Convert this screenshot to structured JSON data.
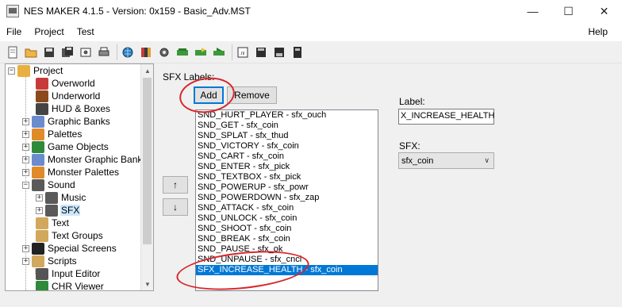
{
  "window": {
    "title": "NES MAKER 4.1.5 - Version: 0x159 - Basic_Adv.MST",
    "min": "—",
    "max": "☐",
    "close": "✕"
  },
  "menu": {
    "file": "File",
    "project": "Project",
    "test": "Test",
    "help": "Help"
  },
  "toolbar": {
    "icons": [
      "new-file-icon",
      "open-folder-icon",
      "save-icon",
      "save-all-icon",
      "export-icon",
      "print-icon",
      "globe-icon",
      "palette-icon",
      "settings-gear-icon",
      "build-icon",
      "build-run-icon",
      "run-icon",
      "asm-icon",
      "disk-icon",
      "disk2-icon",
      "disk3-icon"
    ]
  },
  "tree": {
    "root": "Project",
    "items": [
      {
        "label": "Overworld",
        "icon_color": "#c83a3a"
      },
      {
        "label": "Underworld",
        "icon_color": "#8c4a1c"
      },
      {
        "label": "HUD & Boxes",
        "icon_color": "#444444"
      },
      {
        "label": "Graphic Banks",
        "icon_color": "#6a8ccf"
      },
      {
        "label": "Palettes",
        "icon_color": "#e08a2a"
      },
      {
        "label": "Game Objects",
        "icon_color": "#2f8a3c"
      },
      {
        "label": "Monster Graphic Banks",
        "icon_color": "#6a8ccf"
      },
      {
        "label": "Monster Palettes",
        "icon_color": "#e08a2a"
      },
      {
        "label": "Sound",
        "icon_color": "#5a5a5a"
      },
      {
        "label": "Music",
        "icon_color": "#5a5a5a"
      },
      {
        "label": "SFX",
        "icon_color": "#5a5a5a"
      },
      {
        "label": "Text",
        "icon_color": "#d2a85c"
      },
      {
        "label": "Text Groups",
        "icon_color": "#d2a85c"
      },
      {
        "label": "Special Screens",
        "icon_color": "#222222"
      },
      {
        "label": "Scripts",
        "icon_color": "#d2a85c"
      },
      {
        "label": "Input Editor",
        "icon_color": "#555555"
      },
      {
        "label": "CHR Viewer",
        "icon_color": "#2e8b3a"
      }
    ]
  },
  "sfx_panel": {
    "caption": "SFX Labels:",
    "add_label": "Add",
    "remove_label": "Remove",
    "up_label": "↑",
    "down_label": "↓",
    "list": [
      "SND_HURT_PLAYER - sfx_ouch",
      "SND_GET - sfx_coin",
      "SND_SPLAT - sfx_thud",
      "SND_VICTORY - sfx_coin",
      "SND_CART - sfx_coin",
      "SND_ENTER - sfx_pick",
      "SND_TEXTBOX - sfx_pick",
      "SND_POWERUP - sfx_powr",
      "SND_POWERDOWN - sfx_zap",
      "SND_ATTACK - sfx_coin",
      "SND_UNLOCK - sfx_coin",
      "SND_SHOOT - sfx_coin",
      "SND_BREAK - sfx_coin",
      "SND_PAUSE - sfx_ok",
      "SND_UNPAUSE - sfx_cncl",
      "SFX_INCREASE_HEALTH - sfx_coin"
    ],
    "selected_index": 15
  },
  "properties": {
    "label_caption": "Label:",
    "label_value": "X_INCREASE_HEALTH",
    "sfx_caption": "SFX:",
    "sfx_value": "sfx_coin"
  },
  "colors": {
    "accent": "#0078d7",
    "annotation": "#d8272c"
  }
}
